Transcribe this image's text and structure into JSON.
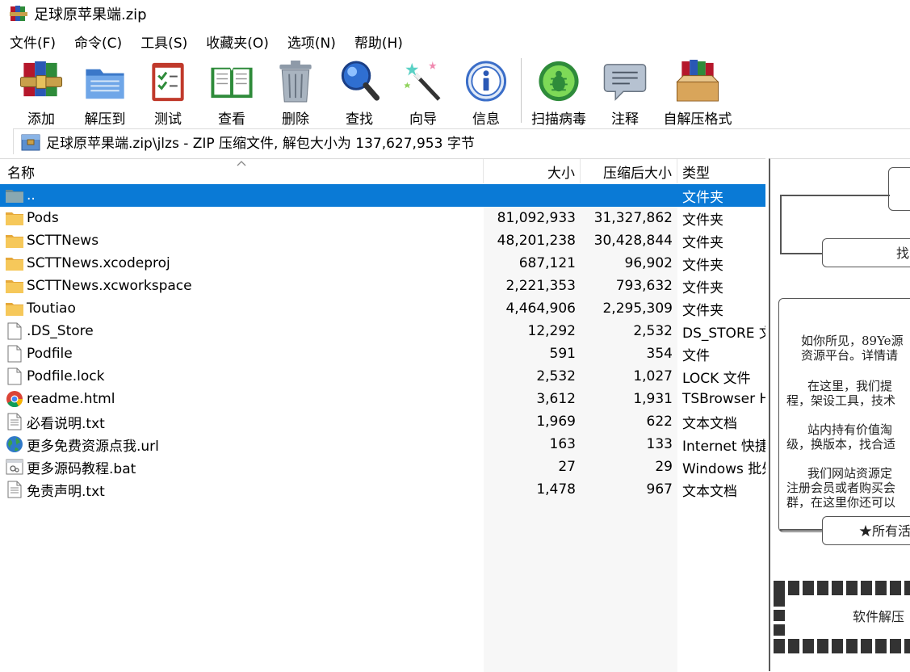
{
  "window": {
    "title": "足球原苹果端.zip"
  },
  "menu": [
    "文件(F)",
    "命令(C)",
    "工具(S)",
    "收藏夹(O)",
    "选项(N)",
    "帮助(H)"
  ],
  "toolbar": [
    {
      "label": "添加",
      "icon": "books-add-icon"
    },
    {
      "label": "解压到",
      "icon": "folder-extract-icon"
    },
    {
      "label": "测试",
      "icon": "clipboard-test-icon"
    },
    {
      "label": "查看",
      "icon": "book-view-icon"
    },
    {
      "label": "删除",
      "icon": "trash-icon"
    },
    {
      "label": "查找",
      "icon": "magnifier-icon"
    },
    {
      "label": "向导",
      "icon": "wand-icon"
    },
    {
      "label": "信息",
      "icon": "info-icon"
    },
    {
      "label": "扫描病毒",
      "icon": "bug-scan-icon"
    },
    {
      "label": "注释",
      "icon": "comment-icon"
    },
    {
      "label": "自解压格式",
      "icon": "sfx-box-icon"
    }
  ],
  "address": {
    "text": "足球原苹果端.zip\\jlzs - ZIP 压缩文件, 解包大小为 137,627,953 字节"
  },
  "columns": {
    "name": "名称",
    "size": "大小",
    "packed": "压缩后大小",
    "type": "类型"
  },
  "files": [
    {
      "name": "..",
      "size": "",
      "packed": "",
      "type": "文件夹",
      "icon": "folder-up-icon",
      "selected": true
    },
    {
      "name": "Pods",
      "size": "81,092,933",
      "packed": "31,327,862",
      "type": "文件夹",
      "icon": "folder-icon"
    },
    {
      "name": "SCTTNews",
      "size": "48,201,238",
      "packed": "30,428,844",
      "type": "文件夹",
      "icon": "folder-icon"
    },
    {
      "name": "SCTTNews.xcodeproj",
      "size": "687,121",
      "packed": "96,902",
      "type": "文件夹",
      "icon": "folder-icon"
    },
    {
      "name": "SCTTNews.xcworkspace",
      "size": "2,221,353",
      "packed": "793,632",
      "type": "文件夹",
      "icon": "folder-icon"
    },
    {
      "name": "Toutiao",
      "size": "4,464,906",
      "packed": "2,295,309",
      "type": "文件夹",
      "icon": "folder-icon"
    },
    {
      "name": ".DS_Store",
      "size": "12,292",
      "packed": "2,532",
      "type": "DS_STORE 文件",
      "icon": "file-icon"
    },
    {
      "name": "Podfile",
      "size": "591",
      "packed": "354",
      "type": "文件",
      "icon": "file-icon"
    },
    {
      "name": "Podfile.lock",
      "size": "2,532",
      "packed": "1,027",
      "type": "LOCK 文件",
      "icon": "file-icon"
    },
    {
      "name": "readme.html",
      "size": "3,612",
      "packed": "1,931",
      "type": "TSBrowser HTML",
      "icon": "chrome-icon"
    },
    {
      "name": "必看说明.txt",
      "size": "1,969",
      "packed": "622",
      "type": "文本文档",
      "icon": "text-file-icon"
    },
    {
      "name": "更多免费资源点我.url",
      "size": "163",
      "packed": "133",
      "type": "Internet 快捷方式",
      "icon": "globe-icon"
    },
    {
      "name": "更多源码教程.bat",
      "size": "27",
      "packed": "29",
      "type": "Windows 批处理文件",
      "icon": "bat-file-icon"
    },
    {
      "name": "免责声明.txt",
      "size": "1,478",
      "packed": "967",
      "type": "文本文档",
      "icon": "text-file-icon"
    }
  ],
  "preview": {
    "box1": "找",
    "para1": [
      "如你所见，89Ye源",
      "资源平台。详情请"
    ],
    "para2": [
      "在这里，我们提",
      "程，架设工具，技术"
    ],
    "para3": [
      "站内持有价值淘",
      "级，换版本，找合适"
    ],
    "para4": [
      "我们网站资源定",
      "注册会员或者购买会",
      "群，在这里你还可以"
    ],
    "box2": "★所有活",
    "footer": "软件解压"
  }
}
